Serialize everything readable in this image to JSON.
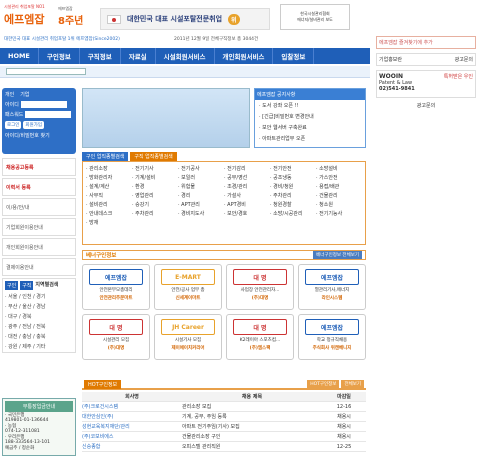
{
  "header": {
    "tagline": "시설관리 취업포탈 NO1",
    "logo": "에프엠잡",
    "anniv_top": "에프엠잡",
    "anniv": "8주년",
    "banner_text": "대한민국 대표 시설포탈전문취업",
    "banner_badge": "위",
    "assoc": "한국시설관리협회",
    "assoc_sub": "에너지/설비관리 보도"
  },
  "subline": "대한민국 대표 시설관리 취업포탈 1위 에프엠잡(Since2002)",
  "date": "2011년 12월 9일 전체구직정보 총 3044건",
  "nav": [
    "HOME",
    "구인정보",
    "구직정보",
    "자료실",
    "시설회원서비스",
    "개인회원서비스",
    "입찰정보"
  ],
  "login": {
    "tab1": "개인",
    "tab2": "기업",
    "id": "아이디",
    "pw": "패스워드",
    "login_btn": "로그인",
    "join_btn": "회원가입",
    "find": "아이디/비밀번호 찾기"
  },
  "left_menu": [
    {
      "label": "채용공고등록",
      "hot": true
    },
    {
      "label": "이력서 등록",
      "hot": true
    },
    {
      "label": "이/용/안/내",
      "hot": false
    },
    {
      "label": "기업회원이용안내",
      "hot": false
    },
    {
      "label": "개인회원이용안내",
      "hot": false
    },
    {
      "label": "결제이용안내",
      "hot": false
    }
  ],
  "region": {
    "tab1": "구인",
    "tab2": "구직",
    "title": "지역별검색",
    "items": [
      "· 서울 / 인천 / 경기",
      "· 부산 / 울산 / 경남",
      "· 대구 / 경북",
      "· 광주 / 전남 / 전북",
      "· 대전 / 충남 / 충북",
      "· 강원 / 제주 / 기타"
    ]
  },
  "bank": {
    "title": "무통장입금안내",
    "lines": [
      "· 국민은행",
      "419801-01-136644",
      "· 농협",
      "074-12-311081",
      "· 우리은행",
      "188-333564-13-101",
      "예금주 / 정순화"
    ]
  },
  "notice": {
    "title": "에프엠잡 공지사항",
    "items": [
      "· 도서 강좌 오픈 !!",
      "· [긴급]비밀번호 변경안내",
      "· 보안 웹서버 구축완료",
      "· 아파트관리업무 오픈"
    ]
  },
  "tabs": [
    "구인 업직종별검색",
    "구직 업직종별검색"
  ],
  "categories": [
    "· 관리소장",
    "· 전기기사",
    "· 전기공사",
    "· 전기감리",
    "· 전기안전",
    "· 소방설비",
    "· 방화관리자",
    "· 기계/설비",
    "· 보일러",
    "· 공무/영선",
    "· 공조냉동",
    "· 가스안전",
    "· 설계/계산",
    "· 환경",
    "· 위험물",
    "· 조경/관리",
    "· 경비/청원",
    "· 용접/배관",
    "· 사무직",
    "· 영업관리",
    "· 경리",
    "· 가설사",
    "· 주차관리",
    "· 건물관리",
    "· 설비관리",
    "· 승강기",
    "· APT관리",
    "· APT경비",
    "· 청원경찰",
    "· 청소원",
    "· 안내데스크",
    "· 주차관리",
    "· 경비지도사",
    "· 보안/경호",
    "· 소방/시공관리",
    "· 전기기능사",
    "· 방재"
  ],
  "premium": {
    "title": "베너구인정보",
    "more": "베너구인정보 전체보기"
  },
  "cards": [
    {
      "logo": "에프엠잡",
      "line1": "안전본부모총데리",
      "company": "안전관리주문마트",
      "color": "#1f5fb8"
    },
    {
      "logo": "E-MART",
      "line1": "안전/공사 업무 총",
      "company": "신세계이마트",
      "color": "#e8a22b"
    },
    {
      "logo": "대 명",
      "line1": "사업장 안전관리자...",
      "company": "(주)대명",
      "color": "#c33"
    },
    {
      "logo": "에프엠잡",
      "line1": "열관리기사,에너지",
      "company": "라인시스템",
      "color": "#1f5fb8"
    },
    {
      "logo": "대 명",
      "line1": "시설관리 모집",
      "company": "(주)대명",
      "color": "#c33"
    },
    {
      "logo": "JH Career",
      "line1": "시설기사 모집",
      "company": "제이에이치커리어",
      "color": "#e8a22b"
    },
    {
      "logo": "대 명",
      "line1": "K2레이아 스포츠컴...",
      "company": "(주)엠스팩",
      "color": "#c33"
    },
    {
      "logo": "에프엠잡",
      "line1": "학교 정규직채용",
      "company": "주식회사 위캔베니지",
      "color": "#1f5fb8"
    }
  ],
  "hot": {
    "title": "HOT구인정보",
    "b1": "HOT구인정보",
    "b2": "전체보기"
  },
  "table": {
    "headers": [
      "회사명",
      "채용 제목",
      "마감일"
    ],
    "rows": [
      [
        "(주)크로건시스템",
        "관리소장 모집",
        "12-16"
      ],
      [
        "대한안심인(주)",
        "기계, 공무, 주임 등록",
        "채용시"
      ],
      [
        "성현교육복지재단/관리",
        "아파트 전기주임(기사) 모집",
        "채용시"
      ],
      [
        "(주)코보비에스",
        "건물관리소장 구인",
        "채용시"
      ],
      [
        "신승종합",
        "오피스텔 관리직원",
        "12-25"
      ]
    ]
  },
  "right": {
    "fav": "에프엠잡 즐겨찾기에 추가",
    "ad_label": "기업홍보란",
    "ad_btn": "광고문의",
    "wooin": "WOOIN",
    "wooin_sub": "Patent & Law",
    "wooin_phone": "02)541-9841",
    "wooin_tag": "특허받은 우인",
    "bottom_btn": "광고문의"
  }
}
